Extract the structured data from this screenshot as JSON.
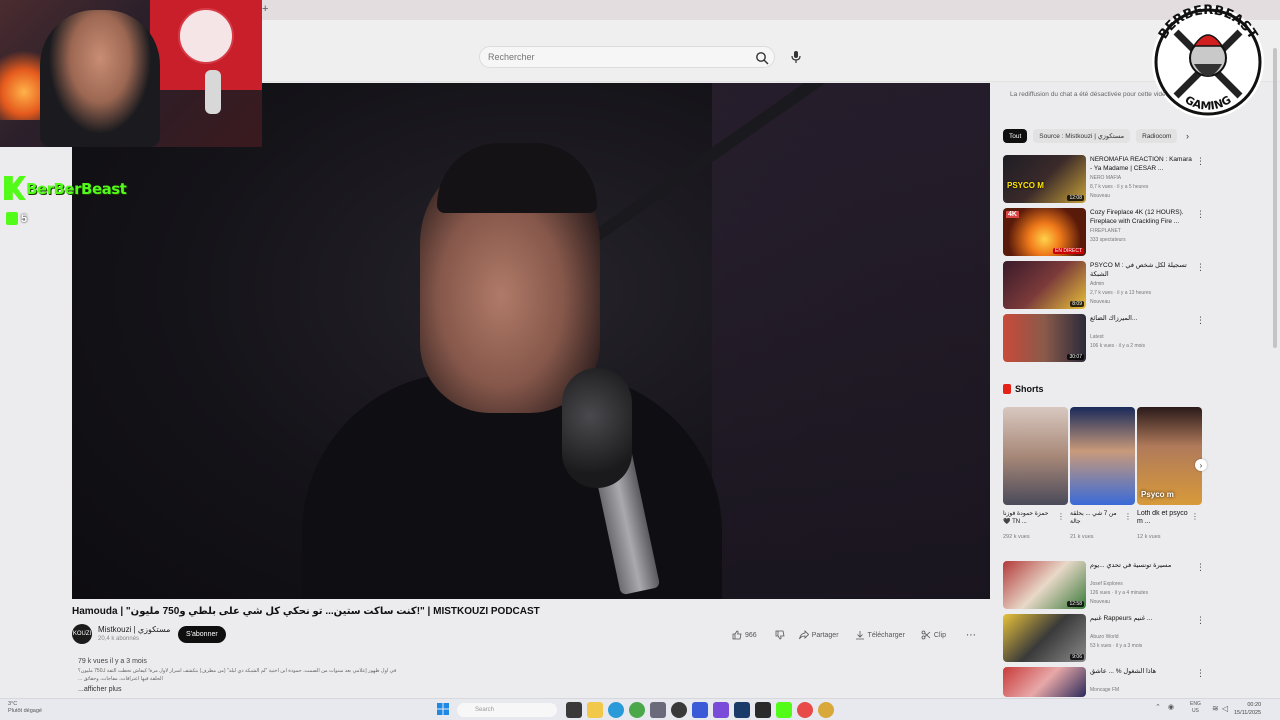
{
  "browser": {
    "new_tab": "+"
  },
  "search": {
    "placeholder": "Rechercher"
  },
  "overlay": {
    "streamer_name": "BerBerBeast",
    "viewer_count": "5",
    "logo_top": "BERBERBEAST",
    "logo_bottom": "GAMING"
  },
  "video": {
    "title": "Hamouda | \"كنت ساكت ستين... تو نحكي كل شي على بلطي و750 مليون!\" | MISTKOUZI PODCAST",
    "channel": "Mistkouzi | مستكوزي",
    "subs": "20,4 k abonnés",
    "avatar_text": "KOUZI",
    "subscribe": "S'abonner",
    "likes": "966",
    "share": "Partager",
    "download": "Télécharger",
    "clip": "Clip",
    "more": "⋯",
    "views_date": "79 k vues  il y a 3 mois",
    "description": "في أول ظهور إعلامي بعد سنوات من الصمت، حمودة ابن أختية \"لم الشبكة دي لبلد\" (من مطرف) بتكشف أسرار لأول مرة! كيفاش تحطت الثقة لـ750 مليون؟",
    "description2": "... الحلقة فيها اعترافات، مفاجآت، وحقائق",
    "show_more": "...afficher plus"
  },
  "sidebar": {
    "chat_note": "La rediffusion du chat a été désactivée pour cette vidéo",
    "chips": [
      "Tout",
      "Source : Mistkouzi | مستكوزي",
      "Radiocom"
    ],
    "chip_next": "›",
    "recs": [
      {
        "title": "NEROMAFIA REACTION : Kamara - Ya Madame | CESAR ...",
        "channel": "NERO MAFIA",
        "meta": "8,7 k vues · il y a 5 heures",
        "badge": "Nouveau",
        "duration": "12:08",
        "thumb_text": "PSYCO M"
      },
      {
        "title": "Cozy Fireplace 4K (12 HOURS). Fireplace with Crackling Fire ...",
        "channel": "FIREPLANET",
        "meta": "333 spectateurs",
        "badge": "",
        "duration": "EN DIRECT",
        "thumb_text": "4K"
      },
      {
        "title": "PSYCO M : تسجيلة لكل شخص في الشبكة",
        "channel": "Admin",
        "meta": "2,7 k vues · il y a 13 heures",
        "badge": "Nouveau",
        "duration": "8:09",
        "thumb_text": ""
      },
      {
        "title": "الميرزاك الضائع...",
        "channel": "Latest",
        "meta": "106 k vues · il y a 2 mois",
        "badge": "",
        "duration": "30:07",
        "thumb_text": ""
      }
    ],
    "shorts_title": "Shorts",
    "shorts": [
      {
        "title": "حمزة حمودة فوزنا 🖤 TN ...",
        "views": "292 k vues",
        "label": ""
      },
      {
        "title": "من 7 شي ... بحلقة جالة",
        "views": "21 k vues",
        "label": ""
      },
      {
        "title": "Lotfi dk et psyco m ...",
        "views": "12 k vues",
        "label": "Psyco m"
      }
    ],
    "shorts_next": "›",
    "recs2": [
      {
        "title": "مسيرة تونسية في تحدي ...يوم",
        "channel": "Josef Explores",
        "meta": "126 vues · il y a 4 minutes",
        "badge": "Nouveau",
        "duration": "12:58"
      },
      {
        "title": "غنيم Rappeurs غنيم ...",
        "channel": "Abuzo World",
        "meta": "53 k vues · il y a 3 mois",
        "badge": "",
        "duration": "9:06"
      },
      {
        "title": "هاذا الشغول % ... عاشق",
        "channel": "Moncage FM",
        "meta": "",
        "badge": "",
        "duration": ""
      }
    ]
  },
  "taskbar": {
    "weather_temp": "3°C",
    "weather_desc": "Plutôt dégagé",
    "search": "Search",
    "lang_top": "ENG",
    "lang_bottom": "US",
    "time": "00:20",
    "date": "15/11/2025"
  }
}
